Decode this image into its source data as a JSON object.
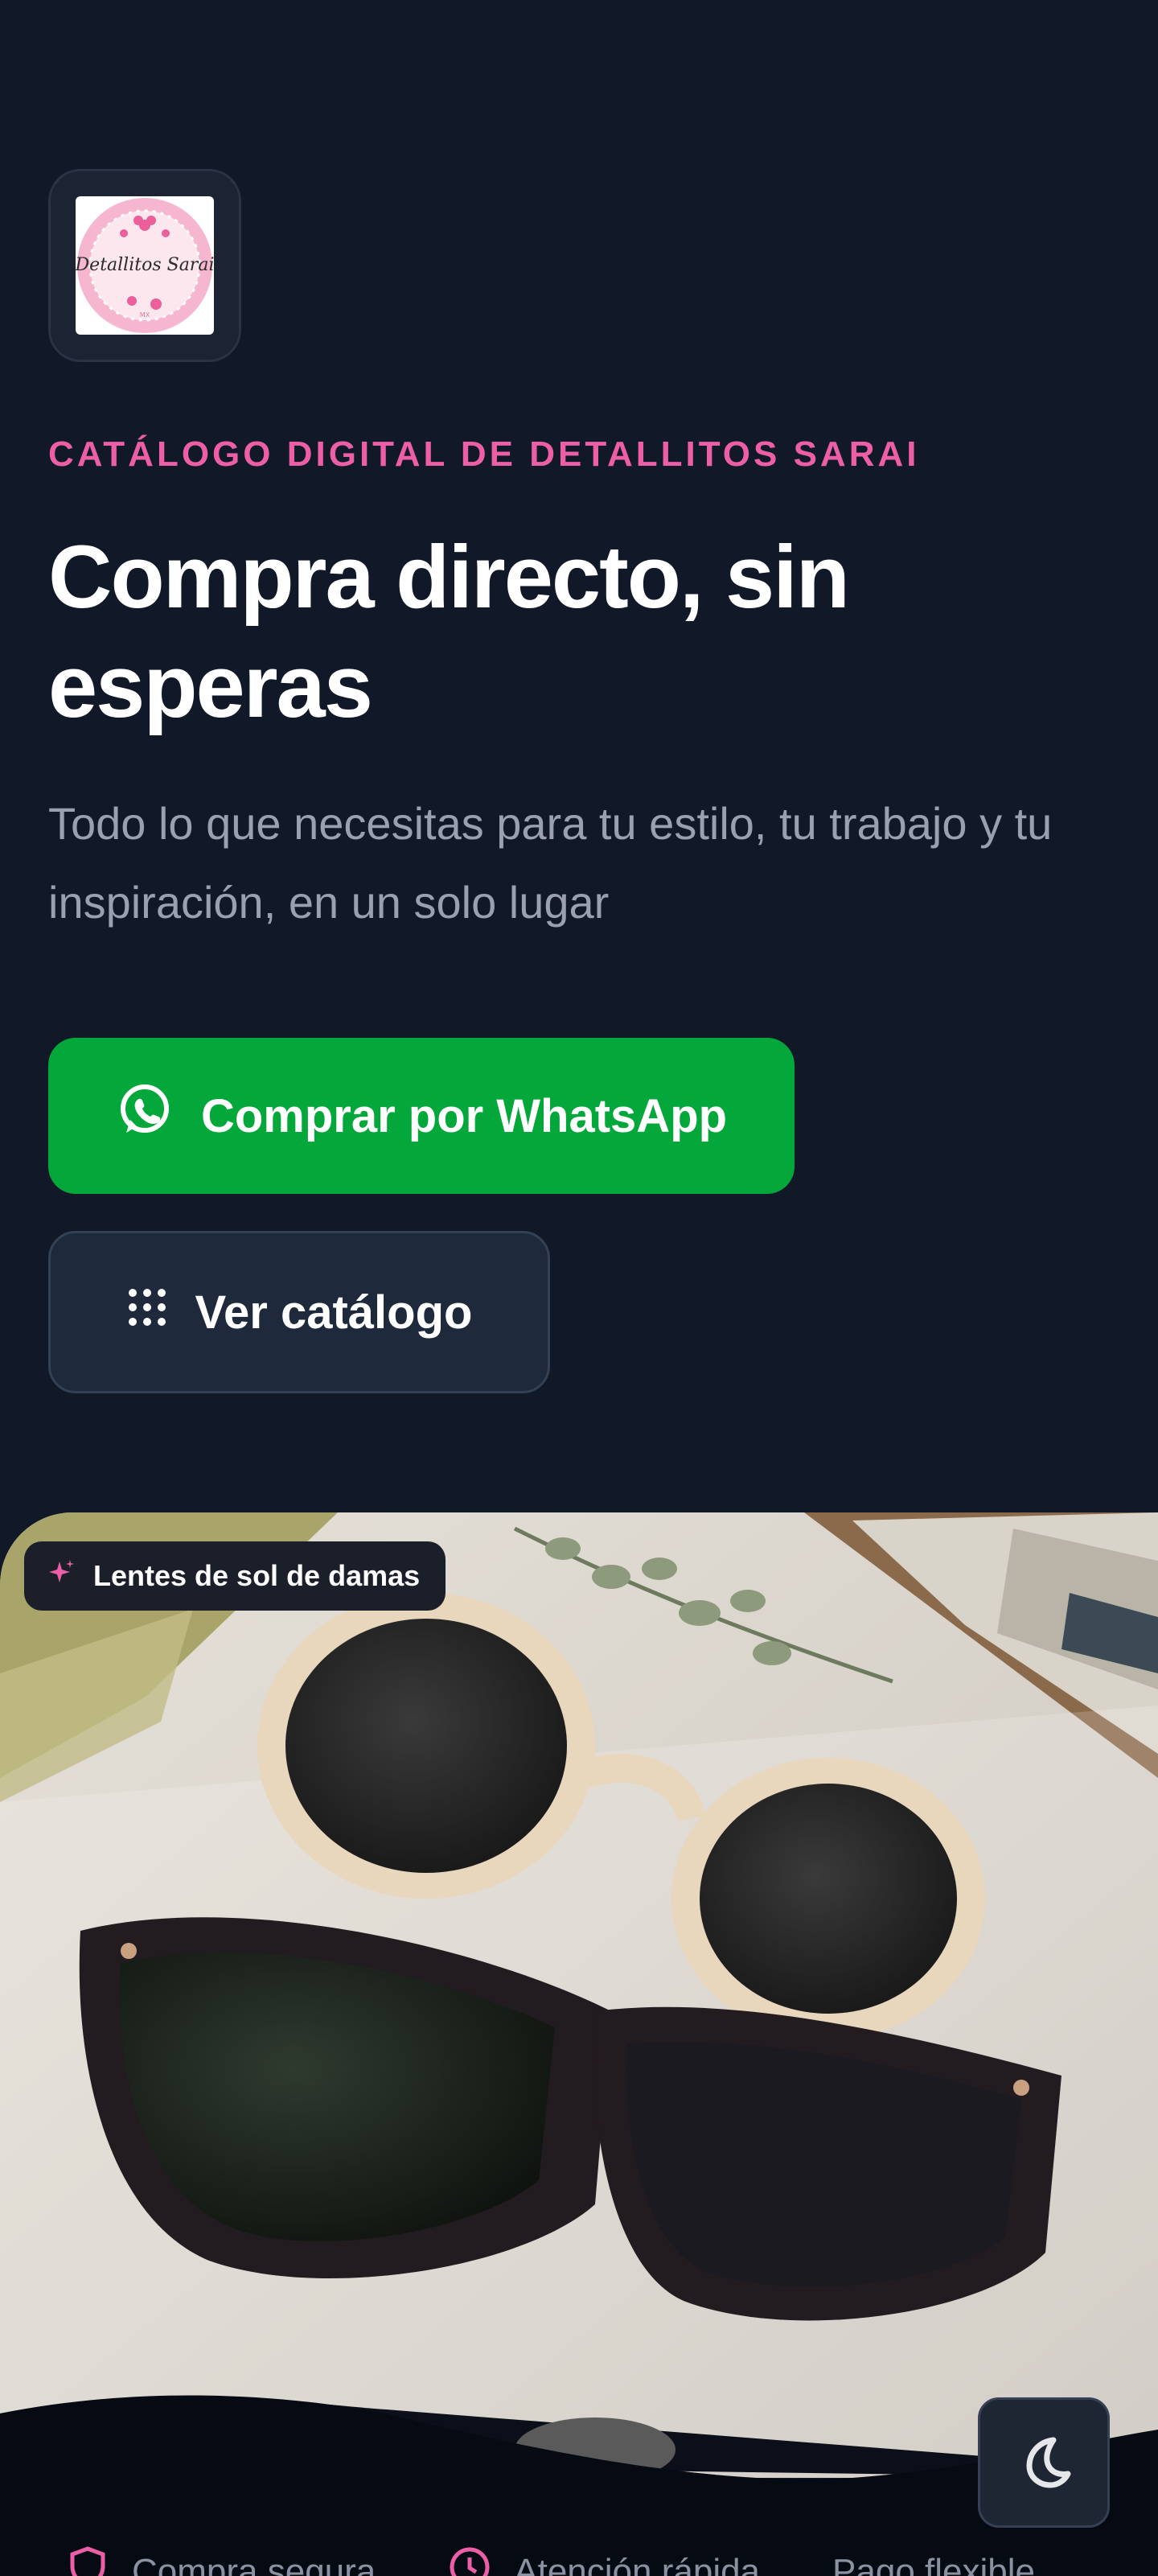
{
  "brand": {
    "logo_script": "Detallitos Sarai",
    "logo_small": "MX"
  },
  "hero": {
    "eyebrow": "CATÁLOGO DIGITAL DE DETALLITOS SARAI",
    "headline": "Compra directo, sin esperas",
    "subtext": "Todo lo que necesitas para tu estilo, tu trabajo y tu inspiración, en un solo lugar"
  },
  "actions": {
    "whatsapp_label": "Comprar por WhatsApp",
    "catalog_label": "Ver catálogo"
  },
  "featured": {
    "tag_label": "Lentes de sol de damas",
    "tag_icon": "sparkle-icon"
  },
  "features": [
    {
      "label": "Compra segura",
      "icon": "shield-icon"
    },
    {
      "label": "Atención rápida",
      "icon": "clock-icon"
    },
    {
      "label": "Pago flexible",
      "icon": "card-icon"
    }
  ],
  "colors": {
    "background": "#111827",
    "accent_pink": "#ec5fa6",
    "whatsapp_green": "#04a83a",
    "muted_text": "#9aa0ad"
  }
}
